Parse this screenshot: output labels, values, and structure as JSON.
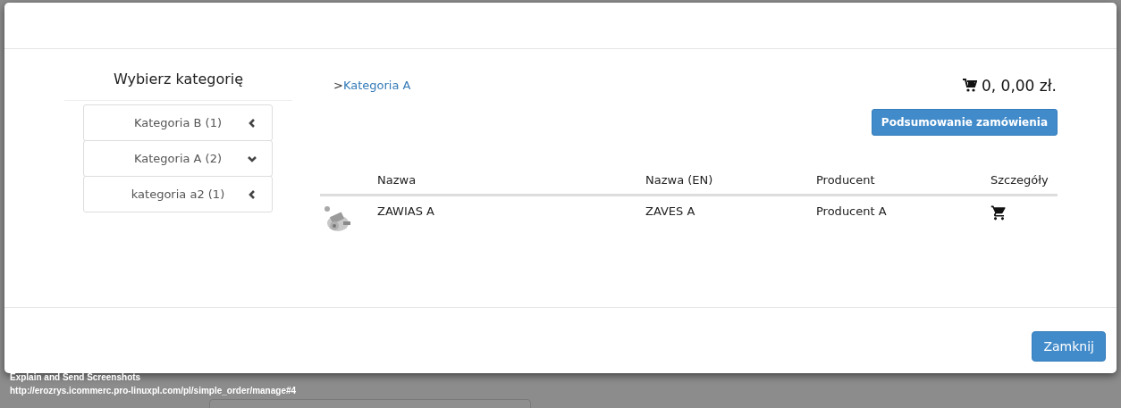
{
  "sidebar": {
    "title": "Wybierz kategorię",
    "items": [
      {
        "label": "Kategoria B (1)",
        "expanded": false
      },
      {
        "label": "Kategoria A (2)",
        "expanded": true
      },
      {
        "label": "kategoria a2 (1)",
        "expanded": false
      }
    ]
  },
  "breadcrumb": {
    "separator": ">",
    "label": "Kategoria A"
  },
  "cart_total": "0, 0,00 zł.",
  "summary_button": "Podsumowanie zamówienia",
  "table": {
    "columns": [
      "Nazwa",
      "Nazwa (EN)",
      "Producent",
      "Szczegóły"
    ],
    "rows": [
      {
        "kind": "picture",
        "name": "ZAWIAS A",
        "name_en": "ZAVES A",
        "producer": "Producent A"
      }
    ]
  },
  "close_button": "Zamknij",
  "overlay": {
    "title": "Explain and Send Screenshots",
    "url": "http://erozrys.icommerc.pro-linuxpl.com/pl/simple_order/manage#4"
  }
}
